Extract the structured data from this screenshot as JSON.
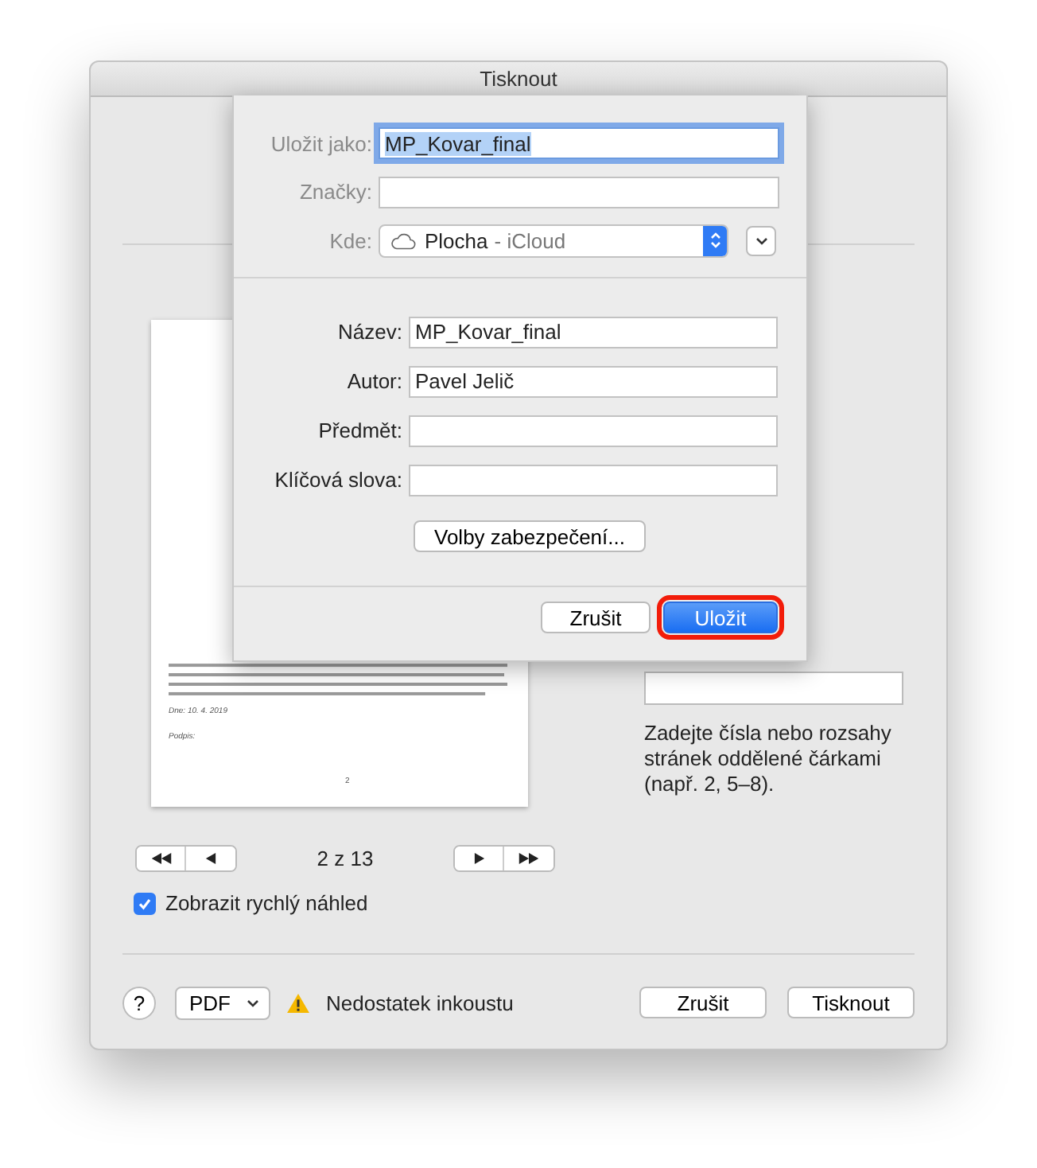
{
  "window": {
    "title": "Tisknout"
  },
  "save_sheet": {
    "top_fields": [
      {
        "label": "Uložit jako:",
        "value": "MP_Kovar_final",
        "focused": true
      },
      {
        "label": "Značky:",
        "focused": false
      }
    ],
    "location": {
      "label": "Kde:",
      "value": "Plocha",
      "detail": "- iCloud"
    },
    "metadata_fields": [
      {
        "label": "Název:",
        "value": "MP_Kovar_final"
      },
      {
        "label": "Autor:",
        "value": "Pavel Jelič"
      },
      {
        "label": "Předmět:"
      },
      {
        "label": "Klíčová slova:"
      }
    ],
    "security_button": "Volby zabezpečení...",
    "buttons": [
      {
        "label": "Zrušit",
        "kind": "cancel",
        "highlighted": false
      },
      {
        "label": "Uložit",
        "kind": "default",
        "highlighted": true
      }
    ]
  },
  "preview": {
    "date": "Dne: 10. 4. 2019",
    "signature": "Podpis:",
    "page_number": "2"
  },
  "navigation": {
    "page_indicator": "2 z 13"
  },
  "quick_preview": {
    "label": "Zobrazit rychlý náhled",
    "checked": true
  },
  "pages_hint": "Zadejte čísla nebo rozsahy stránek oddělené čárkami (např. 2, 5–8).",
  "footer": {
    "help": "?",
    "pdf": "PDF",
    "warning": "Nedostatek inkoustu",
    "buttons": [
      "Zrušit",
      "Tisknout"
    ]
  }
}
